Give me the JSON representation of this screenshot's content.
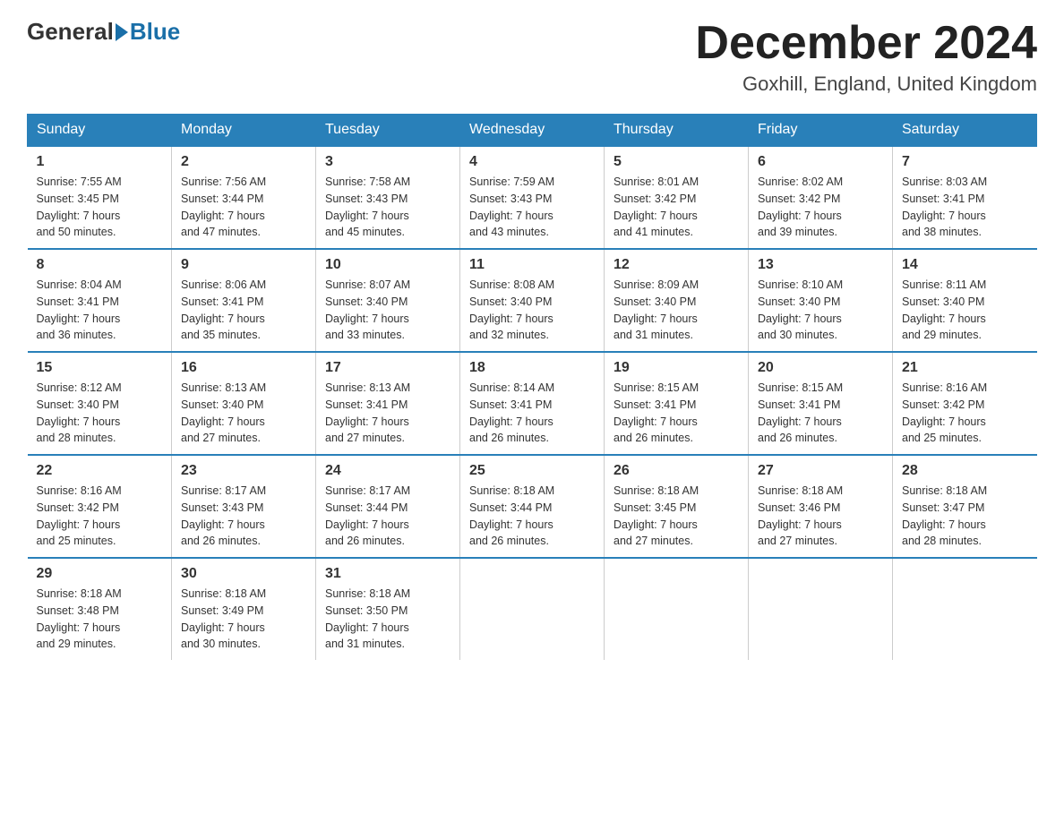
{
  "header": {
    "logo_general": "General",
    "logo_blue": "Blue",
    "month_title": "December 2024",
    "location": "Goxhill, England, United Kingdom"
  },
  "days_of_week": [
    "Sunday",
    "Monday",
    "Tuesday",
    "Wednesday",
    "Thursday",
    "Friday",
    "Saturday"
  ],
  "weeks": [
    [
      {
        "day": "1",
        "sunrise": "7:55 AM",
        "sunset": "3:45 PM",
        "daylight": "7 hours and 50 minutes."
      },
      {
        "day": "2",
        "sunrise": "7:56 AM",
        "sunset": "3:44 PM",
        "daylight": "7 hours and 47 minutes."
      },
      {
        "day": "3",
        "sunrise": "7:58 AM",
        "sunset": "3:43 PM",
        "daylight": "7 hours and 45 minutes."
      },
      {
        "day": "4",
        "sunrise": "7:59 AM",
        "sunset": "3:43 PM",
        "daylight": "7 hours and 43 minutes."
      },
      {
        "day": "5",
        "sunrise": "8:01 AM",
        "sunset": "3:42 PM",
        "daylight": "7 hours and 41 minutes."
      },
      {
        "day": "6",
        "sunrise": "8:02 AM",
        "sunset": "3:42 PM",
        "daylight": "7 hours and 39 minutes."
      },
      {
        "day": "7",
        "sunrise": "8:03 AM",
        "sunset": "3:41 PM",
        "daylight": "7 hours and 38 minutes."
      }
    ],
    [
      {
        "day": "8",
        "sunrise": "8:04 AM",
        "sunset": "3:41 PM",
        "daylight": "7 hours and 36 minutes."
      },
      {
        "day": "9",
        "sunrise": "8:06 AM",
        "sunset": "3:41 PM",
        "daylight": "7 hours and 35 minutes."
      },
      {
        "day": "10",
        "sunrise": "8:07 AM",
        "sunset": "3:40 PM",
        "daylight": "7 hours and 33 minutes."
      },
      {
        "day": "11",
        "sunrise": "8:08 AM",
        "sunset": "3:40 PM",
        "daylight": "7 hours and 32 minutes."
      },
      {
        "day": "12",
        "sunrise": "8:09 AM",
        "sunset": "3:40 PM",
        "daylight": "7 hours and 31 minutes."
      },
      {
        "day": "13",
        "sunrise": "8:10 AM",
        "sunset": "3:40 PM",
        "daylight": "7 hours and 30 minutes."
      },
      {
        "day": "14",
        "sunrise": "8:11 AM",
        "sunset": "3:40 PM",
        "daylight": "7 hours and 29 minutes."
      }
    ],
    [
      {
        "day": "15",
        "sunrise": "8:12 AM",
        "sunset": "3:40 PM",
        "daylight": "7 hours and 28 minutes."
      },
      {
        "day": "16",
        "sunrise": "8:13 AM",
        "sunset": "3:40 PM",
        "daylight": "7 hours and 27 minutes."
      },
      {
        "day": "17",
        "sunrise": "8:13 AM",
        "sunset": "3:41 PM",
        "daylight": "7 hours and 27 minutes."
      },
      {
        "day": "18",
        "sunrise": "8:14 AM",
        "sunset": "3:41 PM",
        "daylight": "7 hours and 26 minutes."
      },
      {
        "day": "19",
        "sunrise": "8:15 AM",
        "sunset": "3:41 PM",
        "daylight": "7 hours and 26 minutes."
      },
      {
        "day": "20",
        "sunrise": "8:15 AM",
        "sunset": "3:41 PM",
        "daylight": "7 hours and 26 minutes."
      },
      {
        "day": "21",
        "sunrise": "8:16 AM",
        "sunset": "3:42 PM",
        "daylight": "7 hours and 25 minutes."
      }
    ],
    [
      {
        "day": "22",
        "sunrise": "8:16 AM",
        "sunset": "3:42 PM",
        "daylight": "7 hours and 25 minutes."
      },
      {
        "day": "23",
        "sunrise": "8:17 AM",
        "sunset": "3:43 PM",
        "daylight": "7 hours and 26 minutes."
      },
      {
        "day": "24",
        "sunrise": "8:17 AM",
        "sunset": "3:44 PM",
        "daylight": "7 hours and 26 minutes."
      },
      {
        "day": "25",
        "sunrise": "8:18 AM",
        "sunset": "3:44 PM",
        "daylight": "7 hours and 26 minutes."
      },
      {
        "day": "26",
        "sunrise": "8:18 AM",
        "sunset": "3:45 PM",
        "daylight": "7 hours and 27 minutes."
      },
      {
        "day": "27",
        "sunrise": "8:18 AM",
        "sunset": "3:46 PM",
        "daylight": "7 hours and 27 minutes."
      },
      {
        "day": "28",
        "sunrise": "8:18 AM",
        "sunset": "3:47 PM",
        "daylight": "7 hours and 28 minutes."
      }
    ],
    [
      {
        "day": "29",
        "sunrise": "8:18 AM",
        "sunset": "3:48 PM",
        "daylight": "7 hours and 29 minutes."
      },
      {
        "day": "30",
        "sunrise": "8:18 AM",
        "sunset": "3:49 PM",
        "daylight": "7 hours and 30 minutes."
      },
      {
        "day": "31",
        "sunrise": "8:18 AM",
        "sunset": "3:50 PM",
        "daylight": "7 hours and 31 minutes."
      },
      null,
      null,
      null,
      null
    ]
  ],
  "labels": {
    "sunrise": "Sunrise:",
    "sunset": "Sunset:",
    "daylight": "Daylight:"
  }
}
